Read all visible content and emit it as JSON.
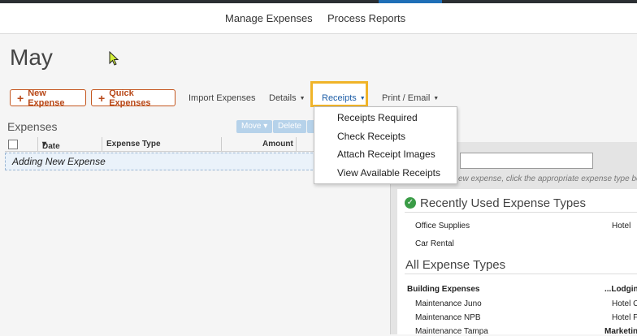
{
  "nav": {
    "manage": "Manage Expenses",
    "process": "Process Reports"
  },
  "page_title": "May",
  "toolbar": {
    "new_expense": "New Expense",
    "quick_expenses": "Quick Expenses",
    "import_expenses": "Import Expenses",
    "details": "Details",
    "receipts": "Receipts",
    "print_email": "Print / Email"
  },
  "receipts_menu": [
    "Receipts Required",
    "Check Receipts",
    "Attach Receipt Images",
    "View Available Receipts"
  ],
  "expenses": {
    "label": "Expenses",
    "move": "Move",
    "delete": "Delete",
    "columns": {
      "date": "Date",
      "type": "Expense Type",
      "amount": "Amount"
    },
    "new_row": "Adding New Expense"
  },
  "side_panel": {
    "hint": "ew expense, click the appropriate expense type belo",
    "recent_title": "Recently Used Expense Types",
    "recent_items": [
      "Office Supplies",
      "Hotel",
      "Car Rental"
    ],
    "all_title": "All Expense Types",
    "cat1": "Building Expenses",
    "cat1_items": [
      "Maintenance Juno",
      "Maintenance NPB",
      "Maintenance Tampa"
    ],
    "cat2": "...Lodgin",
    "cat2_items": [
      "Hotel C",
      "Hotel F"
    ],
    "cat3": "Marketin"
  },
  "colors": {
    "accent": "#c4561e",
    "highlight": "#f0b429",
    "link": "#1f5fa8"
  }
}
